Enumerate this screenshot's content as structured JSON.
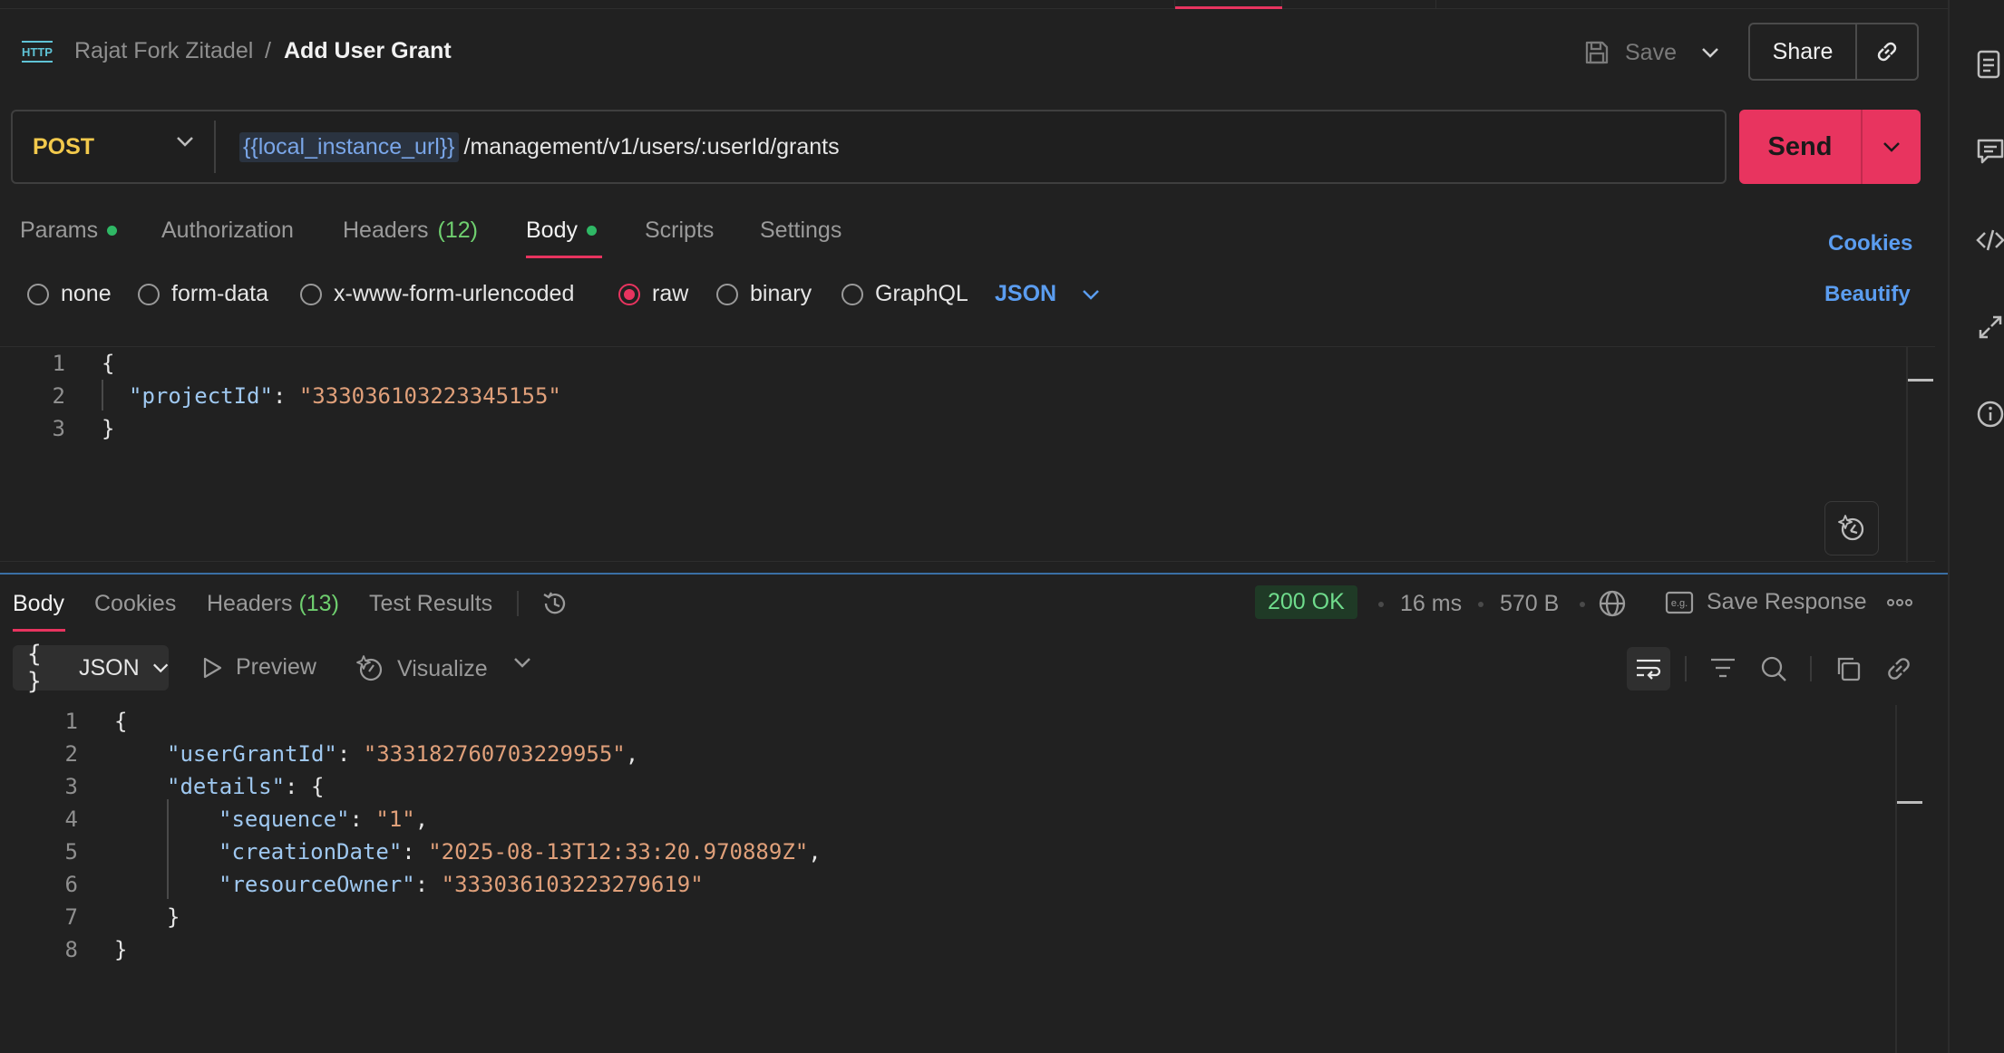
{
  "header": {
    "breadcrumb_parent": "Rajat Fork Zitadel",
    "breadcrumb_separator": "/",
    "title": "Add User Grant",
    "save_label": "Save",
    "share_label": "Share"
  },
  "request": {
    "method": "POST",
    "url_variable": "{{local_instance_url}}",
    "url_path": "/management/v1/users/:userId/grants",
    "send_label": "Send",
    "tabs": [
      {
        "label": "Params",
        "dot": true
      },
      {
        "label": "Authorization"
      },
      {
        "label": "Headers",
        "count": "(12)"
      },
      {
        "label": "Body",
        "dot": true,
        "active": true
      },
      {
        "label": "Scripts"
      },
      {
        "label": "Settings"
      }
    ],
    "cookies_label": "Cookies",
    "body_modes": [
      "none",
      "form-data",
      "x-www-form-urlencoded",
      "raw",
      "binary",
      "GraphQL"
    ],
    "selected_body_mode": "raw",
    "body_format": "JSON",
    "beautify_label": "Beautify",
    "body_lines": [
      "1",
      "2",
      "3"
    ],
    "body": {
      "open": "{",
      "key": "\"projectId\"",
      "colon": ": ",
      "value": "\"333036103223345155\"",
      "close": "}"
    }
  },
  "response": {
    "tabs": [
      {
        "label": "Body",
        "active": true
      },
      {
        "label": "Cookies"
      },
      {
        "label": "Headers",
        "count": "(13)"
      },
      {
        "label": "Test Results"
      }
    ],
    "status": "200 OK",
    "time": "16 ms",
    "size": "570 B",
    "save_response_label": "Save Response",
    "format": "JSON",
    "preview_label": "Preview",
    "visualize_label": "Visualize",
    "line_numbers": [
      "1",
      "2",
      "3",
      "4",
      "5",
      "6",
      "7",
      "8"
    ],
    "json": {
      "open": "{",
      "userGrantId_key": "\"userGrantId\"",
      "userGrantId_value": "\"333182760703229955\"",
      "details_key": "\"details\"",
      "details_open": "{",
      "sequence_key": "\"sequence\"",
      "sequence_value": "\"1\"",
      "creationDate_key": "\"creationDate\"",
      "creationDate_value": "\"2025-08-13T12:33:20.970889Z\"",
      "resourceOwner_key": "\"resourceOwner\"",
      "resourceOwner_value": "\"333036103223279619\"",
      "details_close": "}",
      "close": "}"
    }
  },
  "colors": {
    "accent": "#e8345f",
    "link": "#5b9df0",
    "method": "#f2c94c",
    "status_ok": "#6fdc8c",
    "json_string": "#e0a07a",
    "json_key": "#9fc8f0"
  },
  "icons": [
    "http-icon",
    "save-icon",
    "chevron-down-icon",
    "link-icon",
    "history-icon",
    "globe-icon",
    "example-icon",
    "more-icon",
    "play-icon",
    "visualize-icon",
    "wrap-lines-icon",
    "filter-icon",
    "search-icon",
    "copy-icon",
    "ai-assist-icon",
    "docs-icon",
    "comments-icon",
    "code-icon",
    "related-icon",
    "info-icon"
  ]
}
